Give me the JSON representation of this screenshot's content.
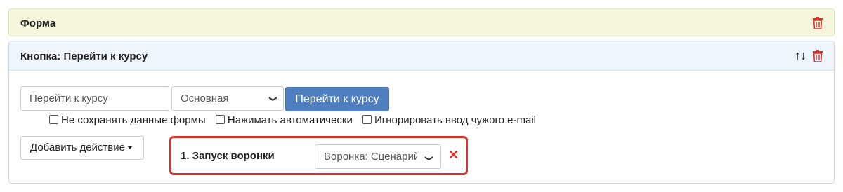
{
  "form_panel": {
    "title": "Форма"
  },
  "button_panel": {
    "title": "Кнопка: Перейти к курсу",
    "arrows": "↑↓",
    "button_text_input": {
      "value": "Перейти к курсу",
      "placeholder": ""
    },
    "style_select": {
      "selected": "Основная"
    },
    "preview_button": "Перейти к курсу",
    "checkboxes": [
      {
        "label": "Не сохранять данные формы",
        "checked": false
      },
      {
        "label": "Нажимать автоматически",
        "checked": false
      },
      {
        "label": "Игнорировать ввод чужого e-mail",
        "checked": false
      }
    ],
    "add_action": "Добавить действие",
    "actions": [
      {
        "label": "1. Запуск воронки",
        "select": "Воронка: Сценарий"
      }
    ]
  },
  "colors": {
    "danger": "#d9332b",
    "primary": "#4f7fbf",
    "form_bg": "#f5f5dc",
    "header_bg": "#eef5fb"
  },
  "icons": [
    "trash-icon",
    "arrow-up-icon",
    "arrow-down-icon",
    "close-icon",
    "chevron-down-icon",
    "caret-down-icon"
  ]
}
